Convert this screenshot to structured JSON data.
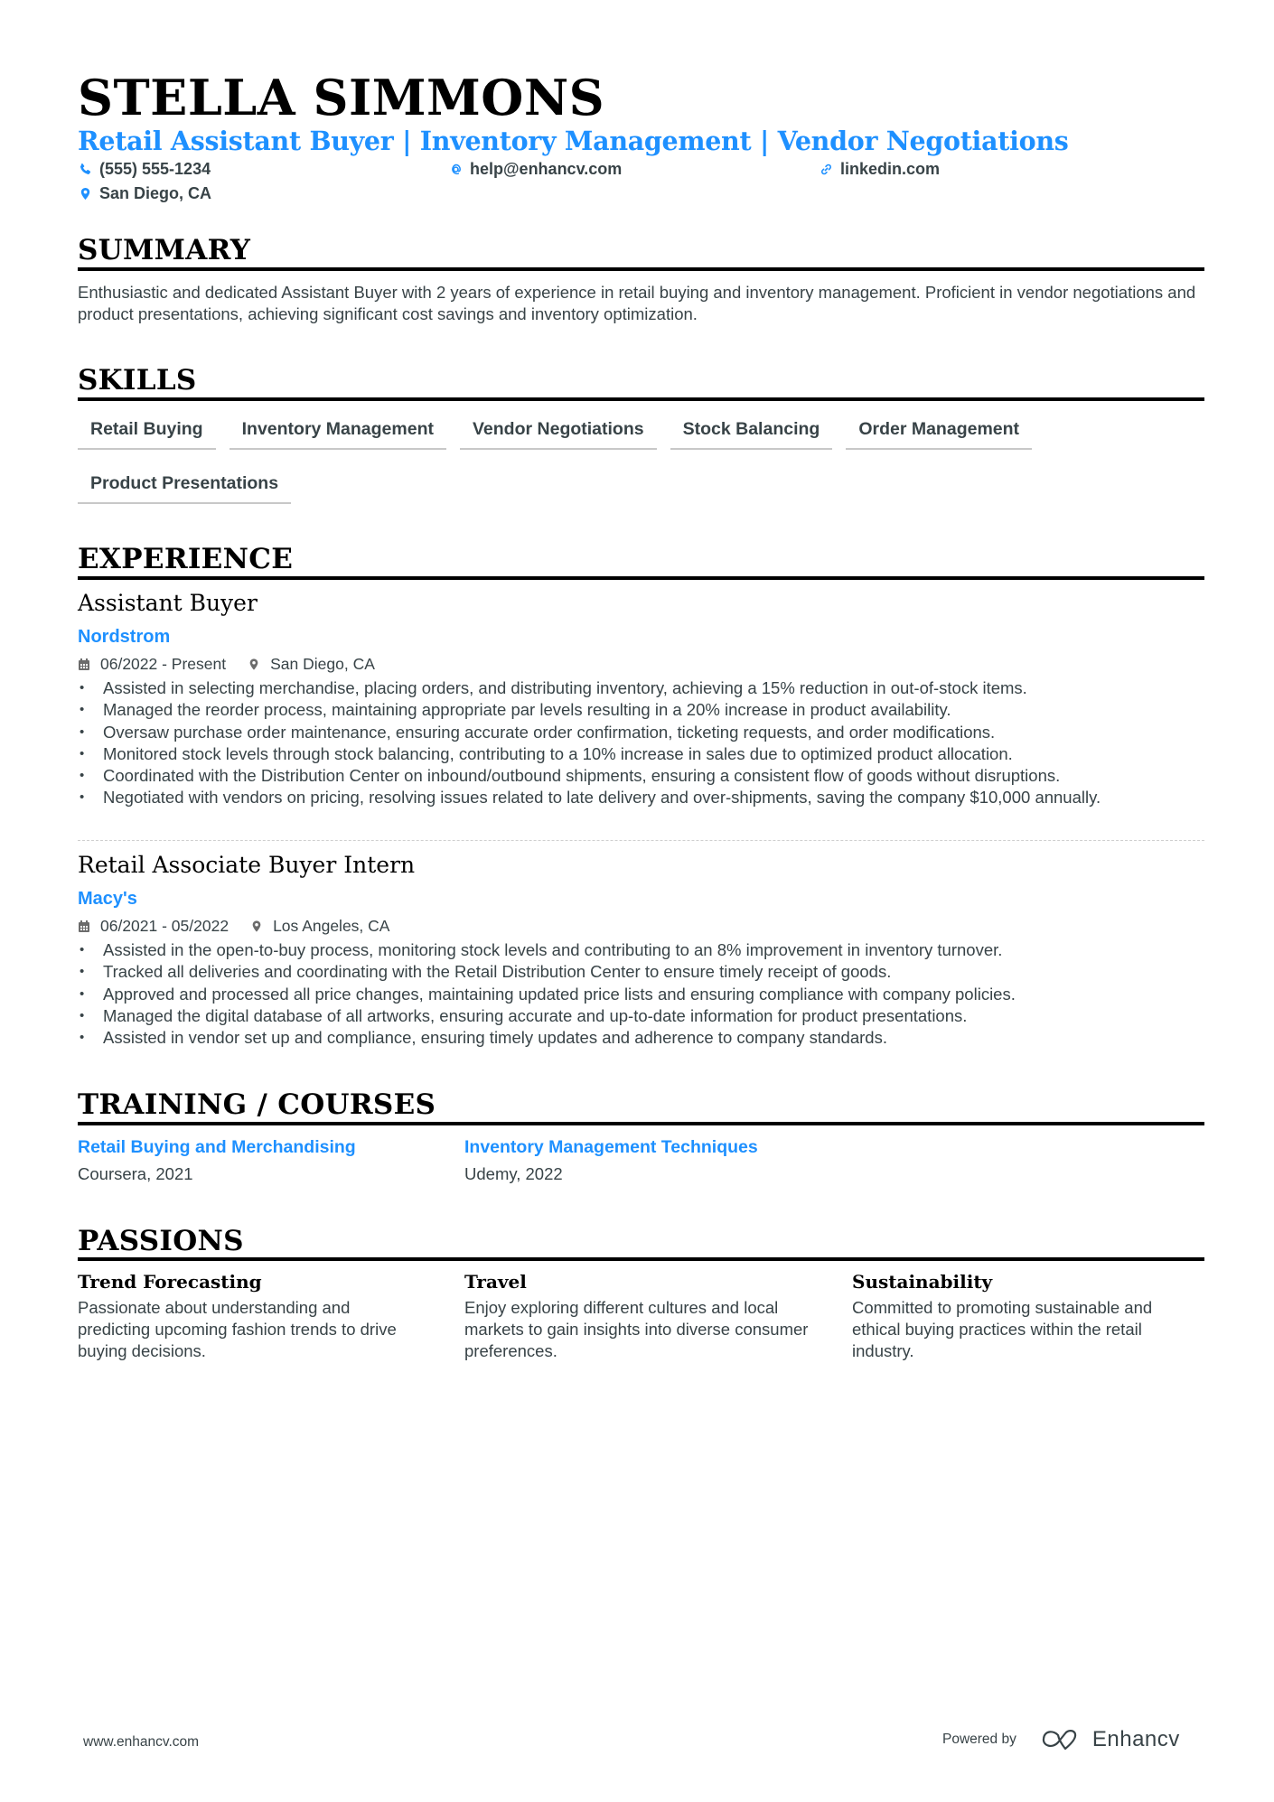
{
  "header": {
    "name": "STELLA SIMMONS",
    "headline": "Retail Assistant Buyer | Inventory Management | Vendor Negotiations",
    "contacts": [
      {
        "icon": "phone-icon",
        "text": "(555) 555-1234"
      },
      {
        "icon": "at-icon",
        "text": "help@enhancv.com"
      },
      {
        "icon": "link-icon",
        "text": "linkedin.com"
      },
      {
        "icon": "location-pin-icon",
        "text": "San Diego, CA"
      }
    ]
  },
  "summary": {
    "title": "SUMMARY",
    "text": "Enthusiastic and dedicated Assistant Buyer with 2 years of experience in retail buying and inventory management. Proficient in vendor negotiations and product presentations, achieving significant cost savings and inventory optimization."
  },
  "skills": {
    "title": "SKILLS",
    "items": [
      "Retail Buying",
      "Inventory Management",
      "Vendor Negotiations",
      "Stock Balancing",
      "Order Management",
      "Product Presentations"
    ]
  },
  "experience": {
    "title": "EXPERIENCE",
    "jobs": [
      {
        "title": "Assistant Buyer",
        "company": "Nordstrom",
        "dates": "06/2022 - Present",
        "location": "San Diego, CA",
        "bullets": [
          "Assisted in selecting merchandise, placing orders, and distributing inventory, achieving a 15% reduction in out-of-stock items.",
          "Managed the reorder process, maintaining appropriate par levels resulting in a 20% increase in product availability.",
          "Oversaw purchase order maintenance, ensuring accurate order confirmation, ticketing requests, and order modifications.",
          "Monitored stock levels through stock balancing, contributing to a 10% increase in sales due to optimized product allocation.",
          "Coordinated with the Distribution Center on inbound/outbound shipments, ensuring a consistent flow of goods without disruptions.",
          "Negotiated with vendors on pricing, resolving issues related to late delivery and over-shipments, saving the company $10,000 annually."
        ]
      },
      {
        "title": "Retail Associate Buyer Intern",
        "company": "Macy's",
        "dates": "06/2021 - 05/2022",
        "location": "Los Angeles, CA",
        "bullets": [
          "Assisted in the open-to-buy process, monitoring stock levels and contributing to an 8% improvement in inventory turnover.",
          "Tracked all deliveries and coordinating with the Retail Distribution Center to ensure timely receipt of goods.",
          "Approved and processed all price changes, maintaining updated price lists and ensuring compliance with company policies.",
          "Managed the digital database of all artworks, ensuring accurate and up-to-date information for product presentations.",
          "Assisted in vendor set up and compliance, ensuring timely updates and adherence to company standards."
        ]
      }
    ]
  },
  "training": {
    "title": "TRAINING / COURSES",
    "items": [
      {
        "title": "Retail Buying and Merchandising",
        "meta": "Coursera, 2021"
      },
      {
        "title": "Inventory Management Techniques",
        "meta": "Udemy, 2022"
      }
    ]
  },
  "passions": {
    "title": "PASSIONS",
    "items": [
      {
        "title": "Trend Forecasting",
        "desc": "Passionate about understanding and predicting upcoming fashion trends to drive buying decisions."
      },
      {
        "title": "Travel",
        "desc": "Enjoy exploring different cultures and local markets to gain insights into diverse consumer preferences."
      },
      {
        "title": "Sustainability",
        "desc": "Committed to promoting sustainable and ethical buying practices within the retail industry."
      }
    ]
  },
  "footer": {
    "website": "www.enhancv.com",
    "powered_by": "Powered by",
    "brand": "Enhancv"
  },
  "colors": {
    "accent": "#1e90ff",
    "text": "#384347",
    "heading": "#000000"
  }
}
